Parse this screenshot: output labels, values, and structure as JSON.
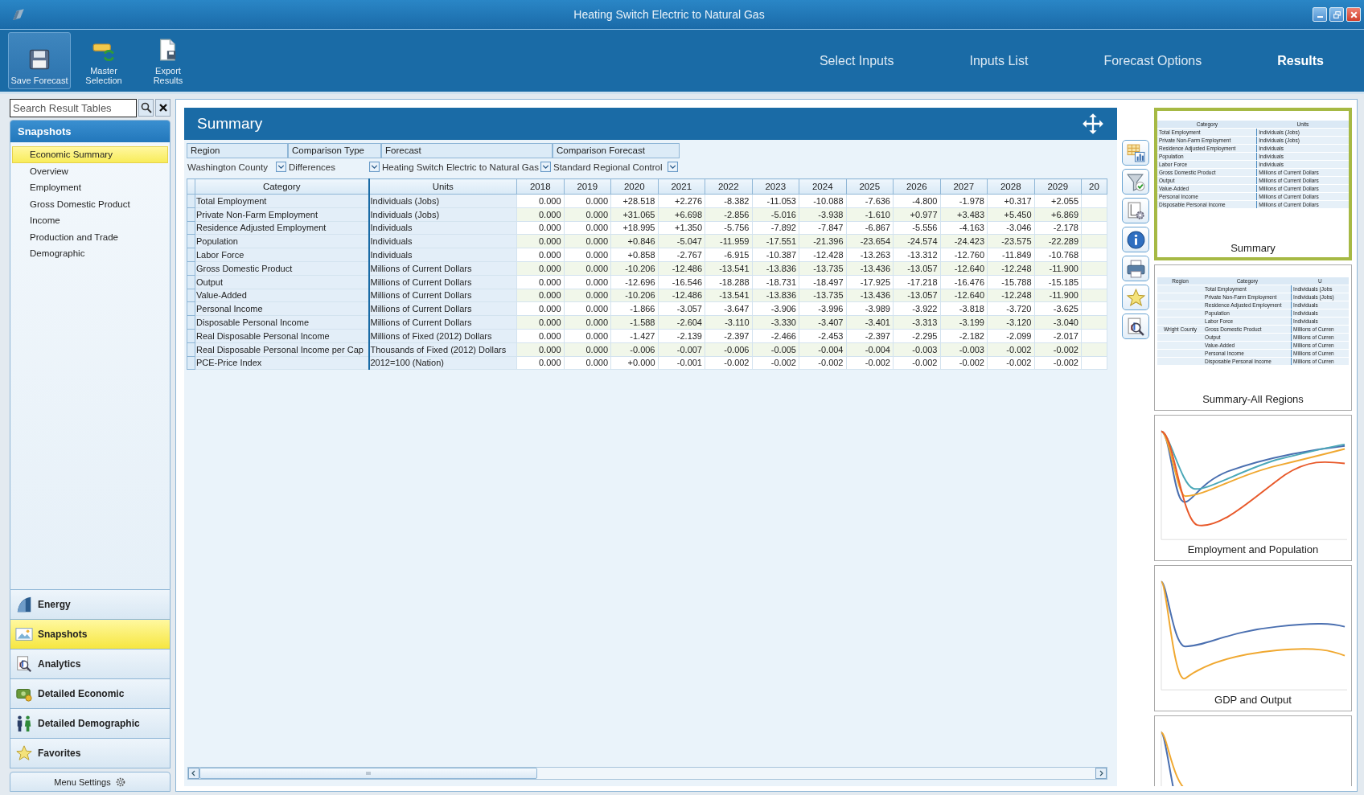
{
  "window": {
    "title": "Heating Switch Electric to Natural Gas"
  },
  "toolbar": [
    {
      "kind": "save",
      "label": "Save Forecast",
      "selected": true
    },
    {
      "kind": "master",
      "label": "Master Selection",
      "selected": false
    },
    {
      "kind": "export",
      "label": "Export Results",
      "selected": false
    }
  ],
  "nav_tabs": [
    {
      "label": "Select Inputs",
      "selected": false
    },
    {
      "label": "Inputs List",
      "selected": false
    },
    {
      "label": "Forecast Options",
      "selected": false
    },
    {
      "label": "Results",
      "selected": true
    }
  ],
  "search": {
    "placeholder": "Search Result Tables"
  },
  "sidebar": {
    "header": "Snapshots",
    "items": [
      {
        "label": "Economic Summary",
        "selected": true
      },
      {
        "label": "Overview",
        "selected": false
      },
      {
        "label": "Employment",
        "selected": false
      },
      {
        "label": "Gross Domestic Product",
        "selected": false
      },
      {
        "label": "Income",
        "selected": false
      },
      {
        "label": "Production and Trade",
        "selected": false
      },
      {
        "label": "Demographic",
        "selected": false
      }
    ],
    "sections": [
      {
        "kind": "energy",
        "label": "Energy",
        "selected": false
      },
      {
        "kind": "snapshots",
        "label": "Snapshots",
        "selected": true
      },
      {
        "kind": "analytics",
        "label": "Analytics",
        "selected": false
      },
      {
        "kind": "economic",
        "label": "Detailed Economic",
        "selected": false
      },
      {
        "kind": "demographic",
        "label": "Detailed Demographic",
        "selected": false
      },
      {
        "kind": "favorites",
        "label": "Favorites",
        "selected": false
      }
    ],
    "settings": "Menu Settings"
  },
  "panel": {
    "title": "Summary",
    "filters": [
      {
        "label": "Region",
        "value": "Washington County"
      },
      {
        "label": "Comparison Type",
        "value": "Differences"
      },
      {
        "label": "Forecast",
        "value": "Heating Switch Electric to Natural Gas"
      },
      {
        "label": "Comparison Forecast",
        "value": "Standard Regional Control"
      }
    ],
    "table": {
      "columns": [
        "Category",
        "Units",
        "2018",
        "2019",
        "2020",
        "2021",
        "2022",
        "2023",
        "2024",
        "2025",
        "2026",
        "2027",
        "2028",
        "2029",
        "20"
      ],
      "rows": [
        {
          "category": "Total Employment",
          "units": "Individuals (Jobs)",
          "values": [
            "0.000",
            "0.000",
            "+28.518",
            "+2.276",
            "-8.382",
            "-11.053",
            "-10.088",
            "-7.636",
            "-4.800",
            "-1.978",
            "+0.317",
            "+2.055"
          ]
        },
        {
          "category": "Private Non-Farm Employment",
          "units": "Individuals (Jobs)",
          "values": [
            "0.000",
            "0.000",
            "+31.065",
            "+6.698",
            "-2.856",
            "-5.016",
            "-3.938",
            "-1.610",
            "+0.977",
            "+3.483",
            "+5.450",
            "+6.869"
          ]
        },
        {
          "category": "Residence Adjusted Employment",
          "units": "Individuals",
          "values": [
            "0.000",
            "0.000",
            "+18.995",
            "+1.350",
            "-5.756",
            "-7.892",
            "-7.847",
            "-6.867",
            "-5.556",
            "-4.163",
            "-3.046",
            "-2.178"
          ]
        },
        {
          "category": "Population",
          "units": "Individuals",
          "values": [
            "0.000",
            "0.000",
            "+0.846",
            "-5.047",
            "-11.959",
            "-17.551",
            "-21.396",
            "-23.654",
            "-24.574",
            "-24.423",
            "-23.575",
            "-22.289"
          ]
        },
        {
          "category": "Labor Force",
          "units": "Individuals",
          "values": [
            "0.000",
            "0.000",
            "+0.858",
            "-2.767",
            "-6.915",
            "-10.387",
            "-12.428",
            "-13.263",
            "-13.312",
            "-12.760",
            "-11.849",
            "-10.768"
          ]
        },
        {
          "category": "Gross Domestic Product",
          "units": "Millions of Current Dollars",
          "values": [
            "0.000",
            "0.000",
            "-10.206",
            "-12.486",
            "-13.541",
            "-13.836",
            "-13.735",
            "-13.436",
            "-13.057",
            "-12.640",
            "-12.248",
            "-11.900"
          ]
        },
        {
          "category": "Output",
          "units": "Millions of Current Dollars",
          "values": [
            "0.000",
            "0.000",
            "-12.696",
            "-16.546",
            "-18.288",
            "-18.731",
            "-18.497",
            "-17.925",
            "-17.218",
            "-16.476",
            "-15.788",
            "-15.185"
          ]
        },
        {
          "category": "Value-Added",
          "units": "Millions of Current Dollars",
          "values": [
            "0.000",
            "0.000",
            "-10.206",
            "-12.486",
            "-13.541",
            "-13.836",
            "-13.735",
            "-13.436",
            "-13.057",
            "-12.640",
            "-12.248",
            "-11.900"
          ]
        },
        {
          "category": "Personal Income",
          "units": "Millions of Current Dollars",
          "values": [
            "0.000",
            "0.000",
            "-1.866",
            "-3.057",
            "-3.647",
            "-3.906",
            "-3.996",
            "-3.989",
            "-3.922",
            "-3.818",
            "-3.720",
            "-3.625"
          ]
        },
        {
          "category": "Disposable Personal Income",
          "units": "Millions of Current Dollars",
          "values": [
            "0.000",
            "0.000",
            "-1.588",
            "-2.604",
            "-3.110",
            "-3.330",
            "-3.407",
            "-3.401",
            "-3.313",
            "-3.199",
            "-3.120",
            "-3.040"
          ]
        },
        {
          "category": "Real Disposable Personal Income",
          "units": "Millions of Fixed (2012) Dollars",
          "values": [
            "0.000",
            "0.000",
            "-1.427",
            "-2.139",
            "-2.397",
            "-2.466",
            "-2.453",
            "-2.397",
            "-2.295",
            "-2.182",
            "-2.099",
            "-2.017"
          ]
        },
        {
          "category": "Real Disposable Personal Income per Cap",
          "units": "Thousands of Fixed (2012) Dollars",
          "values": [
            "0.000",
            "0.000",
            "-0.006",
            "-0.007",
            "-0.006",
            "-0.005",
            "-0.004",
            "-0.004",
            "-0.003",
            "-0.003",
            "-0.002",
            "-0.002"
          ]
        },
        {
          "category": "PCE-Price Index",
          "units": "2012=100 (Nation)",
          "values": [
            "0.000",
            "0.000",
            "+0.000",
            "-0.001",
            "-0.002",
            "-0.002",
            "-0.002",
            "-0.002",
            "-0.002",
            "-0.002",
            "-0.002",
            "-0.002"
          ]
        }
      ]
    }
  },
  "thumbnails": [
    {
      "kind": "table",
      "title": "Summary",
      "selected": true,
      "columns": [
        "Category",
        "Units"
      ],
      "rows": [
        [
          "Total Employment",
          "Individuals (Jobs)"
        ],
        [
          "Private Non-Farm Employment",
          "Individuals (Jobs)"
        ],
        [
          "Residence Adjusted Employment",
          "Individuals"
        ],
        [
          "Population",
          "Individuals"
        ],
        [
          "Labor Force",
          "Individuals"
        ],
        [
          "Gross Domestic Product",
          "Millions of Current Dollars"
        ],
        [
          "Output",
          "Millions of Current Dollars"
        ],
        [
          "Value-Added",
          "Millions of Current Dollars"
        ],
        [
          "Personal Income",
          "Millions of Current Dollars"
        ],
        [
          "Disposable Personal Income",
          "Millions of Current Dollars"
        ]
      ]
    },
    {
      "kind": "region_table",
      "title": "Summary-All Regions",
      "selected": false,
      "columns": [
        "Region",
        "Category",
        "U"
      ],
      "rows": [
        [
          "",
          "Total Employment",
          "Individuals (Jobs"
        ],
        [
          "",
          "Private Non-Farm Employment",
          "Individuals (Jobs)"
        ],
        [
          "",
          "Residence Adjusted Employment",
          "Individuals"
        ],
        [
          "",
          "Population",
          "Individuals"
        ],
        [
          "",
          "Labor Force",
          "Individuals"
        ],
        [
          "Wright County",
          "Gross Domestic Product",
          "Millions of Curren"
        ],
        [
          "",
          "Output",
          "Millions of Curren"
        ],
        [
          "",
          "Value-Added",
          "Millions of Curren"
        ],
        [
          "",
          "Personal Income",
          "Millions of Curren"
        ],
        [
          "",
          "Disposable Personal Income",
          "Millions of Curren"
        ]
      ]
    },
    {
      "kind": "chart",
      "title": "Employment and Population",
      "selected": false
    },
    {
      "kind": "chart",
      "title": "GDP and Output",
      "selected": false
    },
    {
      "kind": "chart",
      "selected": false
    }
  ]
}
